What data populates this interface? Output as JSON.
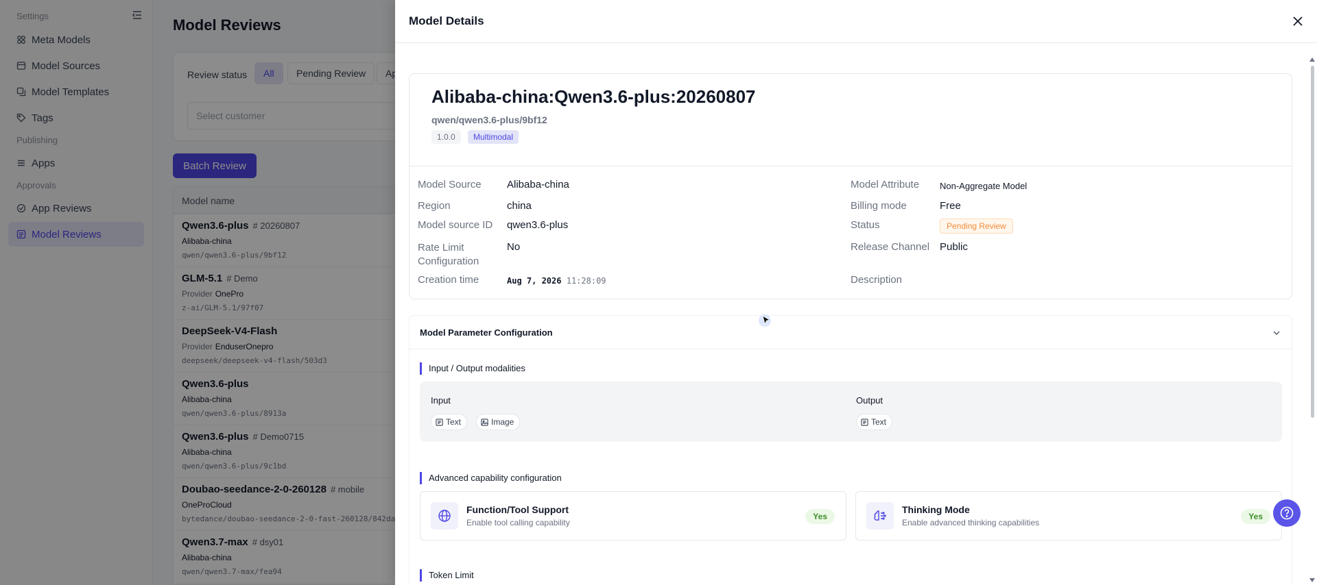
{
  "sidebar": {
    "sections": {
      "settings": "Settings",
      "publishing": "Publishing",
      "approvals": "Approvals"
    },
    "items": [
      {
        "label": "Meta Models",
        "icon": "meta-models-icon"
      },
      {
        "label": "Model Sources",
        "icon": "model-sources-icon"
      },
      {
        "label": "Model Templates",
        "icon": "model-templates-icon"
      },
      {
        "label": "Tags",
        "icon": "tag-icon"
      },
      {
        "label": "Apps",
        "icon": "apps-icon"
      },
      {
        "label": "App Reviews",
        "icon": "app-reviews-icon"
      },
      {
        "label": "Model Reviews",
        "icon": "model-reviews-icon",
        "active": true
      }
    ]
  },
  "main": {
    "title": "Model Reviews",
    "filter": {
      "label": "Review status",
      "chips": [
        "All",
        "Pending Review",
        "Ap"
      ],
      "customer_placeholder": "Select customer"
    },
    "batch_button": "Batch Review",
    "table": {
      "header": "Model name",
      "rows": [
        {
          "name": "Qwen3.6-plus",
          "tag": "20260807",
          "sub_prefix": "",
          "sub": "Alibaba-china",
          "path": "qwen/qwen3.6-plus/9bf12"
        },
        {
          "name": "GLM-5.1",
          "tag": "Demo",
          "sub_prefix": "Provider",
          "sub": "OnePro",
          "path": "z-ai/GLM-5.1/97f07"
        },
        {
          "name": "DeepSeek-V4-Flash",
          "tag": "",
          "sub_prefix": "Provider",
          "sub": "EnduserOnepro",
          "path": "deepseek/deepseek-v4-flash/503d3"
        },
        {
          "name": "Qwen3.6-plus",
          "tag": "",
          "sub_prefix": "",
          "sub": "Alibaba-china",
          "path": "qwen/qwen3.6-plus/8913a"
        },
        {
          "name": "Qwen3.6-plus",
          "tag": "Demo0715",
          "sub_prefix": "",
          "sub": "Alibaba-china",
          "path": "qwen/qwen3.6-plus/9c1bd"
        },
        {
          "name": "Doubao-seedance-2-0-260128",
          "tag": "mobile",
          "sub_prefix": "",
          "sub": "OneProCloud",
          "path": "bytedance/doubao-seedance-2-0-fast-260128/842da"
        },
        {
          "name": "Qwen3.7-max",
          "tag": "dsy01",
          "sub_prefix": "",
          "sub": "Alibaba-china",
          "path": "qwen/qwen3.7-max/fea94"
        }
      ]
    }
  },
  "drawer": {
    "title": "Model Details",
    "model": {
      "full_name": "Alibaba-china:Qwen3.6-plus:20260807",
      "path": "qwen/qwen3.6-plus/9bf12",
      "version": "1.0.0",
      "type_badge": "Multimodal"
    },
    "fields": {
      "model_source": {
        "label": "Model Source",
        "value": "Alibaba-china"
      },
      "region": {
        "label": "Region",
        "value": "china"
      },
      "model_source_id": {
        "label": "Model source ID",
        "value": "qwen3.6-plus"
      },
      "rate_limit": {
        "label": "Rate Limit Configuration",
        "value": "No"
      },
      "creation_time": {
        "label": "Creation time",
        "date": "Aug 7, 2026",
        "time": "11:28:09"
      },
      "model_attribute": {
        "label": "Model Attribute",
        "value": "Non-Aggregate Model"
      },
      "billing_mode": {
        "label": "Billing mode",
        "value": "Free"
      },
      "status": {
        "label": "Status",
        "value": "Pending Review"
      },
      "release_channel": {
        "label": "Release Channel",
        "value": "Public"
      },
      "description": {
        "label": "Description",
        "value": ""
      }
    },
    "params": {
      "title": "Model Parameter Configuration",
      "io_section": "Input / Output modalities",
      "input_label": "Input",
      "output_label": "Output",
      "inputs": [
        "Text",
        "Image"
      ],
      "outputs": [
        "Text"
      ],
      "advanced_section": "Advanced capability configuration",
      "capabilities": [
        {
          "title": "Function/Tool Support",
          "desc": "Enable tool calling capability",
          "value": "Yes"
        },
        {
          "title": "Thinking Mode",
          "desc": "Enable advanced thinking capabilities",
          "value": "Yes"
        }
      ],
      "token_section": "Token Limit"
    }
  },
  "colors": {
    "accent": "#4f46e5",
    "status_pending": "#f08c3b",
    "yes_green": "#3d8f28"
  }
}
